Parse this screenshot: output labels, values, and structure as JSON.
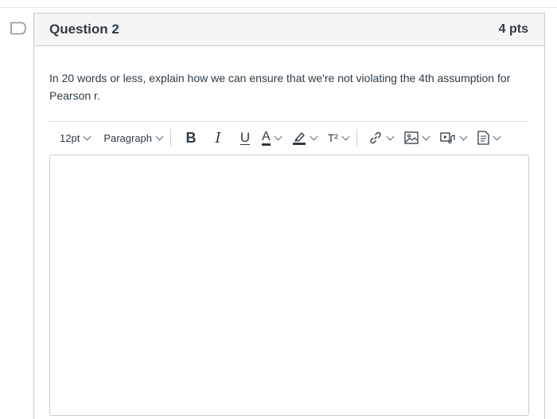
{
  "question": {
    "title": "Question 2",
    "points": "4 pts",
    "text": "In 20 words or less, explain how we can ensure that we're not violating the 4th assumption for Pearson r."
  },
  "toolbar": {
    "font_size": "12pt",
    "block_format": "Paragraph",
    "buttons": [
      "bold",
      "italic",
      "underline",
      "text-color",
      "highlight-color",
      "superscript",
      "link",
      "image",
      "media",
      "document"
    ],
    "bold_glyph": "B",
    "italic_glyph": "I",
    "underline_glyph": "U",
    "text_color_glyph": "A",
    "superscript_glyph": "T²"
  },
  "editor": {
    "content": ""
  },
  "icons": {
    "flag": "flag-outline-icon",
    "link": "link-icon",
    "image": "image-icon",
    "media": "media-icon",
    "document": "document-icon"
  }
}
